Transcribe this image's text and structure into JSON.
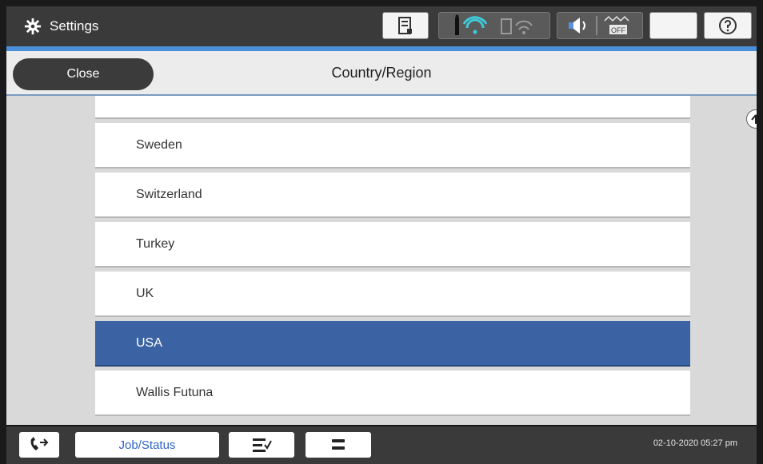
{
  "app": {
    "title": "Settings",
    "icon": "gear-icon"
  },
  "status_icons": [
    "printer-status-icon",
    "wifi-icon",
    "wifi-direct-icon",
    "speaker-icon",
    "eco-off-icon",
    "sleep-moon-icon",
    "help-icon"
  ],
  "header": {
    "close_label": "Close",
    "title": "Country/Region"
  },
  "list": {
    "items": [
      {
        "label": "Sweden",
        "selected": false
      },
      {
        "label": "Switzerland",
        "selected": false
      },
      {
        "label": "Turkey",
        "selected": false
      },
      {
        "label": "UK",
        "selected": false
      },
      {
        "label": "USA",
        "selected": true
      },
      {
        "label": "Wallis Futuna",
        "selected": false
      }
    ],
    "selected_color": "#3b63a4"
  },
  "footer": {
    "job_status_label": "Job/Status",
    "datetime": "02-10-2020 05:27 pm"
  },
  "colors": {
    "accent": "#4b8fd8",
    "link_blue": "#2f63c6"
  }
}
